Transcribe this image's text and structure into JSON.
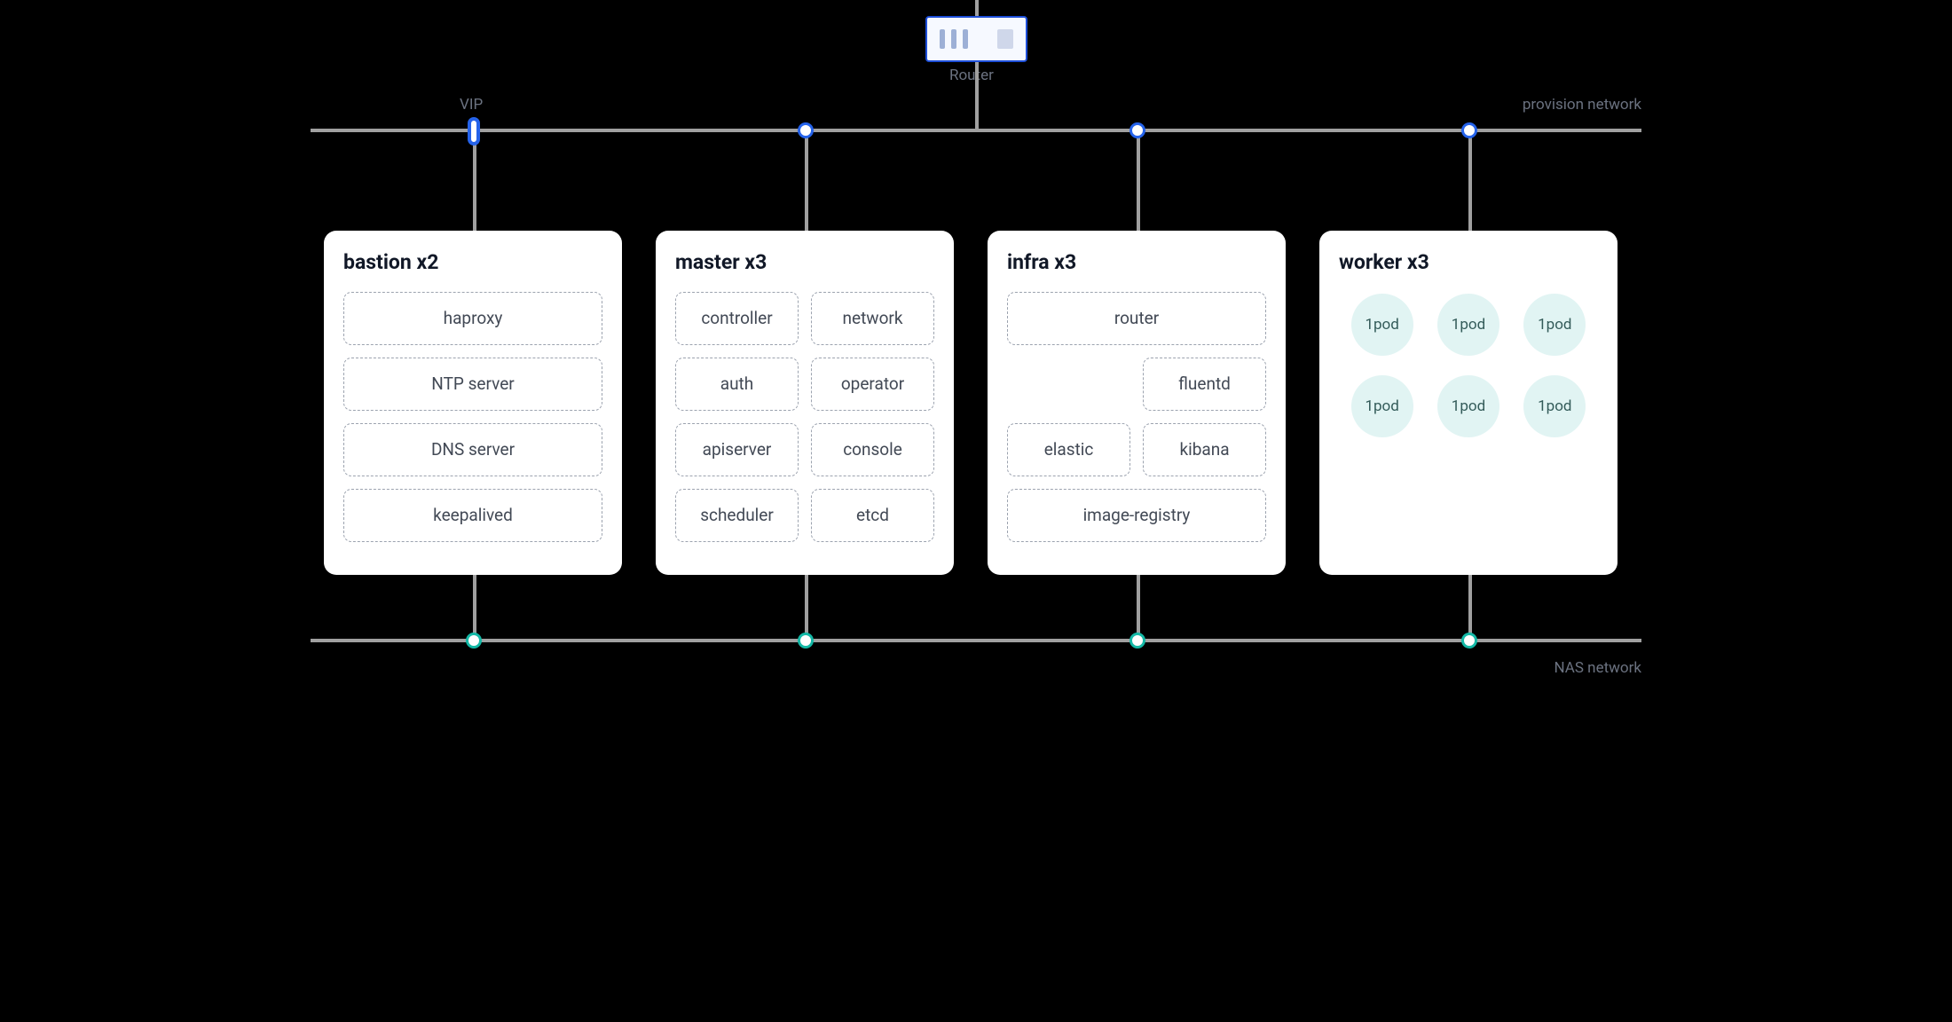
{
  "router_label": "Router",
  "vip_label": "VIP",
  "provision_label": "provision network",
  "nas_label": "NAS network",
  "colors": {
    "provision": "#2563EB",
    "nas": "#14B8A6",
    "card_bg": "#FFFFFF",
    "pod_bg": "#E1F4F3"
  },
  "cards": {
    "bastion": {
      "title": "bastion x2",
      "items": [
        "haproxy",
        "NTP server",
        "DNS server",
        "keepalived"
      ]
    },
    "master": {
      "title": "master x3",
      "rows": [
        [
          "controller",
          "network"
        ],
        [
          "auth",
          "operator"
        ],
        [
          "apiserver",
          "console"
        ],
        [
          "scheduler",
          "etcd"
        ]
      ]
    },
    "infra": {
      "title": "infra x3",
      "router_full": "router",
      "fluentd": "fluentd",
      "elastic": "elastic",
      "kibana": "kibana",
      "image_registry_full": "image-registry"
    },
    "worker": {
      "title": "worker x3",
      "pod_label": "1pod",
      "pod_count": 6
    }
  }
}
